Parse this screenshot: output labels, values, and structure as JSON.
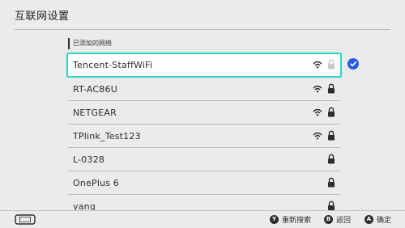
{
  "header": {
    "title": "互联网设置"
  },
  "section": {
    "label": "已添加的网络"
  },
  "networks": [
    {
      "name": "Tencent-StaffWiFi",
      "wifi": true,
      "locked": true,
      "selected": true
    },
    {
      "name": "RT-AC86U",
      "wifi": true,
      "locked": true
    },
    {
      "name": "NETGEAR",
      "wifi": true,
      "locked": true
    },
    {
      "name": "TPlink_Test123",
      "wifi": true,
      "locked": true
    },
    {
      "name": "L-0328",
      "wifi": false,
      "locked": true
    },
    {
      "name": "OnePlus 6",
      "wifi": false,
      "locked": true
    },
    {
      "name": "yang",
      "wifi": false,
      "locked": true
    }
  ],
  "footer": {
    "hints": [
      {
        "button": "Y",
        "label": "重新搜索"
      },
      {
        "button": "B",
        "label": "返回"
      },
      {
        "button": "A",
        "label": "确定"
      }
    ]
  },
  "colors": {
    "accent": "#2fd6c0",
    "check": "#2b5bdc",
    "background": "#ebebeb"
  }
}
